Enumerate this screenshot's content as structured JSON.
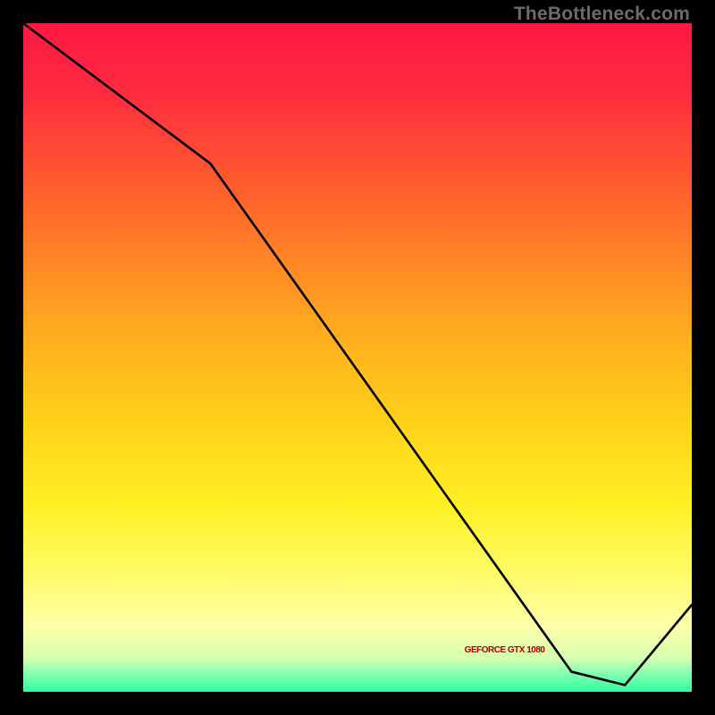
{
  "watermark": "TheBottleneck.com",
  "chart_data": {
    "type": "line",
    "title": "",
    "xlabel": "",
    "ylabel": "",
    "xlim": [
      0,
      100
    ],
    "ylim": [
      0,
      100
    ],
    "grid": false,
    "x": [
      0,
      28,
      82,
      90,
      100
    ],
    "values": [
      100,
      79,
      3,
      1,
      13
    ],
    "note": "values read off the plotted line; y=0 is bottom, y=100 is top. Minimum at x≈90.",
    "gradient_stops": [
      {
        "pct": 0.0,
        "color": "#ff1744"
      },
      {
        "pct": 10.0,
        "color": "#ff2a3f"
      },
      {
        "pct": 28.0,
        "color": "#ff6a2a"
      },
      {
        "pct": 45.0,
        "color": "#ffa81f"
      },
      {
        "pct": 60.0,
        "color": "#ffd21a"
      },
      {
        "pct": 72.0,
        "color": "#fff024"
      },
      {
        "pct": 82.0,
        "color": "#fffb66"
      },
      {
        "pct": 90.0,
        "color": "#fdffa8"
      },
      {
        "pct": 95.0,
        "color": "#d6ffb0"
      },
      {
        "pct": 97.0,
        "color": "#8dffb0"
      },
      {
        "pct": 100.0,
        "color": "#2cffa2"
      }
    ],
    "bar_label": {
      "text": "GEFORCE GTX 1080",
      "x_pct": 66,
      "y_pct_from_top": 93
    }
  }
}
